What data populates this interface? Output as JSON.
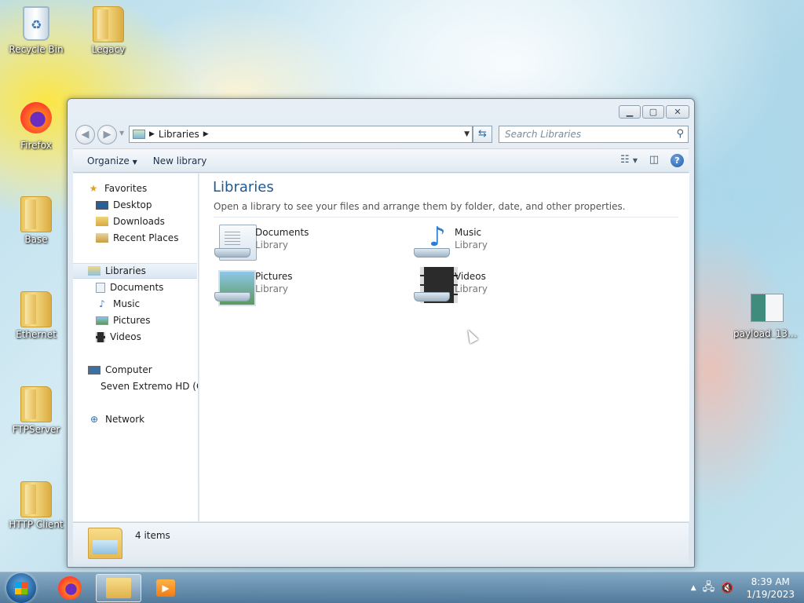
{
  "desktop": {
    "icons": [
      {
        "label": "Recycle Bin",
        "icon": "recycle-bin-icon"
      },
      {
        "label": "Legacy",
        "icon": "folder-icon"
      },
      {
        "label": "Firefox",
        "icon": "firefox-icon"
      },
      {
        "label": "Base",
        "icon": "folder-icon"
      },
      {
        "label": "Ethernet",
        "icon": "folder-icon"
      },
      {
        "label": "FTPServer",
        "icon": "folder-icon"
      },
      {
        "label": "HTTP Client",
        "icon": "folder-icon"
      },
      {
        "label": "payload_136M...",
        "icon": "file-icon"
      }
    ]
  },
  "explorer": {
    "address": {
      "crumb": "Libraries"
    },
    "search_placeholder": "Search Libraries",
    "toolbar": {
      "organize": "Organize",
      "new_library": "New library"
    },
    "nav": {
      "favorites": {
        "label": "Favorites",
        "items": [
          "Desktop",
          "Downloads",
          "Recent Places"
        ]
      },
      "libraries": {
        "label": "Libraries",
        "items": [
          "Documents",
          "Music",
          "Pictures",
          "Videos"
        ]
      },
      "computer": {
        "label": "Computer",
        "items": [
          "Seven Extremo HD (C"
        ]
      },
      "network": {
        "label": "Network"
      }
    },
    "content": {
      "title": "Libraries",
      "description": "Open a library to see your files and arrange them by folder, date, and other properties.",
      "libraries": [
        {
          "name": "Documents",
          "kind": "Library"
        },
        {
          "name": "Music",
          "kind": "Library"
        },
        {
          "name": "Pictures",
          "kind": "Library"
        },
        {
          "name": "Videos",
          "kind": "Library"
        }
      ]
    },
    "status": {
      "count": "4 items"
    }
  },
  "taskbar": {
    "clock": {
      "time": "8:39 AM",
      "date": "1/19/2023"
    }
  }
}
